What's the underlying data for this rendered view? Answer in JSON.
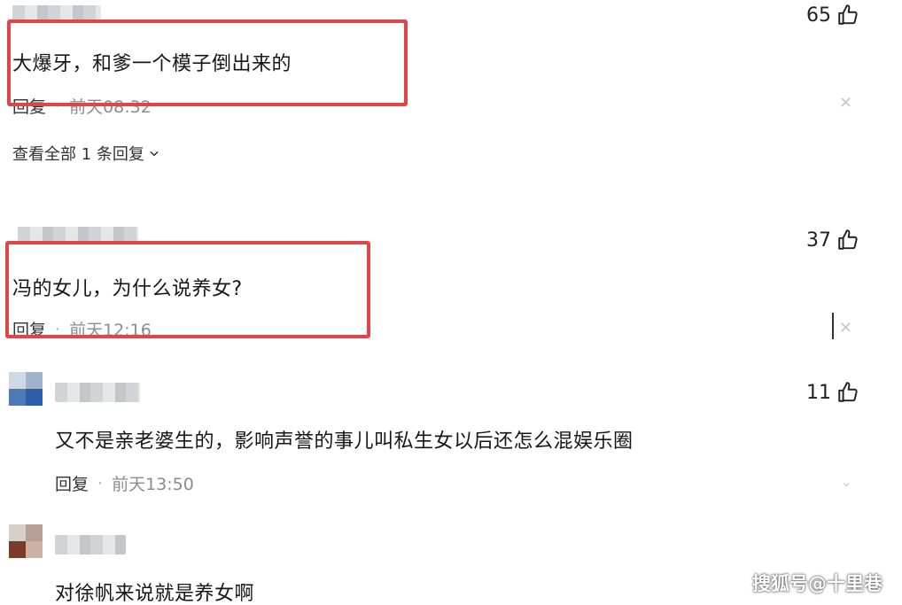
{
  "comments": [
    {
      "likes": "65",
      "text": "大爆牙，和爹一个模子倒出来的",
      "reply_label": "回复",
      "time": "前天08:32"
    },
    {
      "likes": "37",
      "text": "冯的女儿，为什么说养女?",
      "reply_label": "回复",
      "time": "前天12:16"
    },
    {
      "likes": "11",
      "text": "又不是亲老婆生的，影响声誉的事儿叫私生女以后还怎么混娱乐圈",
      "reply_label": "回复",
      "time": "前天13:50"
    },
    {
      "text": "对徐帆来说就是养女啊"
    }
  ],
  "view_all_replies": "查看全部 1 条回复",
  "separator": "·",
  "watermark": "搜狐号@十里巷",
  "icons": {
    "like": "thumbs-up-icon",
    "close": "close-icon",
    "expand": "chevron-down-icon"
  },
  "colors": {
    "highlight": "#e0454a",
    "text": "#161616",
    "time": "#8c8c8c"
  }
}
